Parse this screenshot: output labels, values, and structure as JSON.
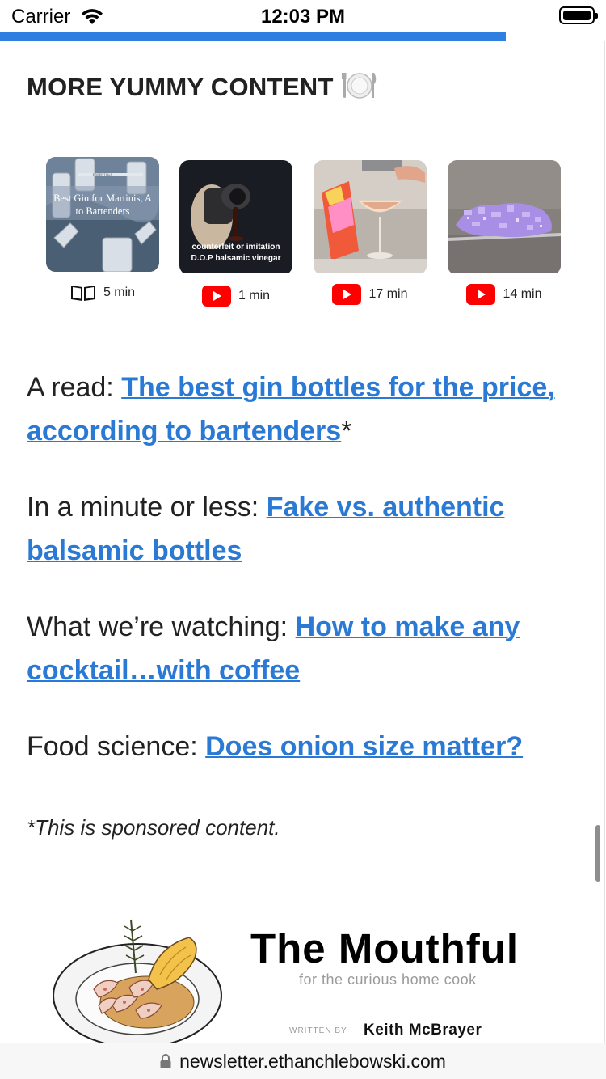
{
  "status_bar": {
    "carrier": "Carrier",
    "time": "12:03 PM"
  },
  "reading_progress": {
    "percent": 83.5,
    "color": "#2f7fe0"
  },
  "section": {
    "title": "MORE YUMMY CONTENT",
    "emoji": "plate-with-cutlery"
  },
  "thumbnails": [
    {
      "image_text": "Best Gin for Martinis, According to Bartenders",
      "small_text": "ESSENTIALS",
      "media_icon": "book-icon",
      "duration": "5 min"
    },
    {
      "image_text": "counterfeit or imitation",
      "image_text_2": "D.O.P balsamic vinegar",
      "media_icon": "youtube-icon",
      "duration": "1 min"
    },
    {
      "media_icon": "youtube-icon",
      "duration": "17 min"
    },
    {
      "media_icon": "youtube-icon",
      "duration": "14 min"
    }
  ],
  "links": [
    {
      "prefix": "A read: ",
      "link": "The best gin bottles for the price, according to bartenders",
      "suffix": "*"
    },
    {
      "prefix": "In a minute or less: ",
      "link": "Fake vs. authentic balsamic bottles",
      "suffix": ""
    },
    {
      "prefix": "What we’re watching: ",
      "link": "How to make any cocktail…with coffee",
      "suffix": ""
    },
    {
      "prefix": "Food science: ",
      "link": "Does onion size matter?",
      "suffix": ""
    }
  ],
  "sponsored_note": "*This is sponsored content.",
  "brand": {
    "title": "The Mouthful",
    "subtitle": "for the curious home cook",
    "written_by": "WRITTEN BY",
    "author": "Keith McBrayer"
  },
  "url_bar": {
    "url": "newsletter.ethanchlebowski.com"
  },
  "colors": {
    "link": "#2a7ad5",
    "progress": "#2f7fe0",
    "youtube_red": "#ff0000"
  }
}
